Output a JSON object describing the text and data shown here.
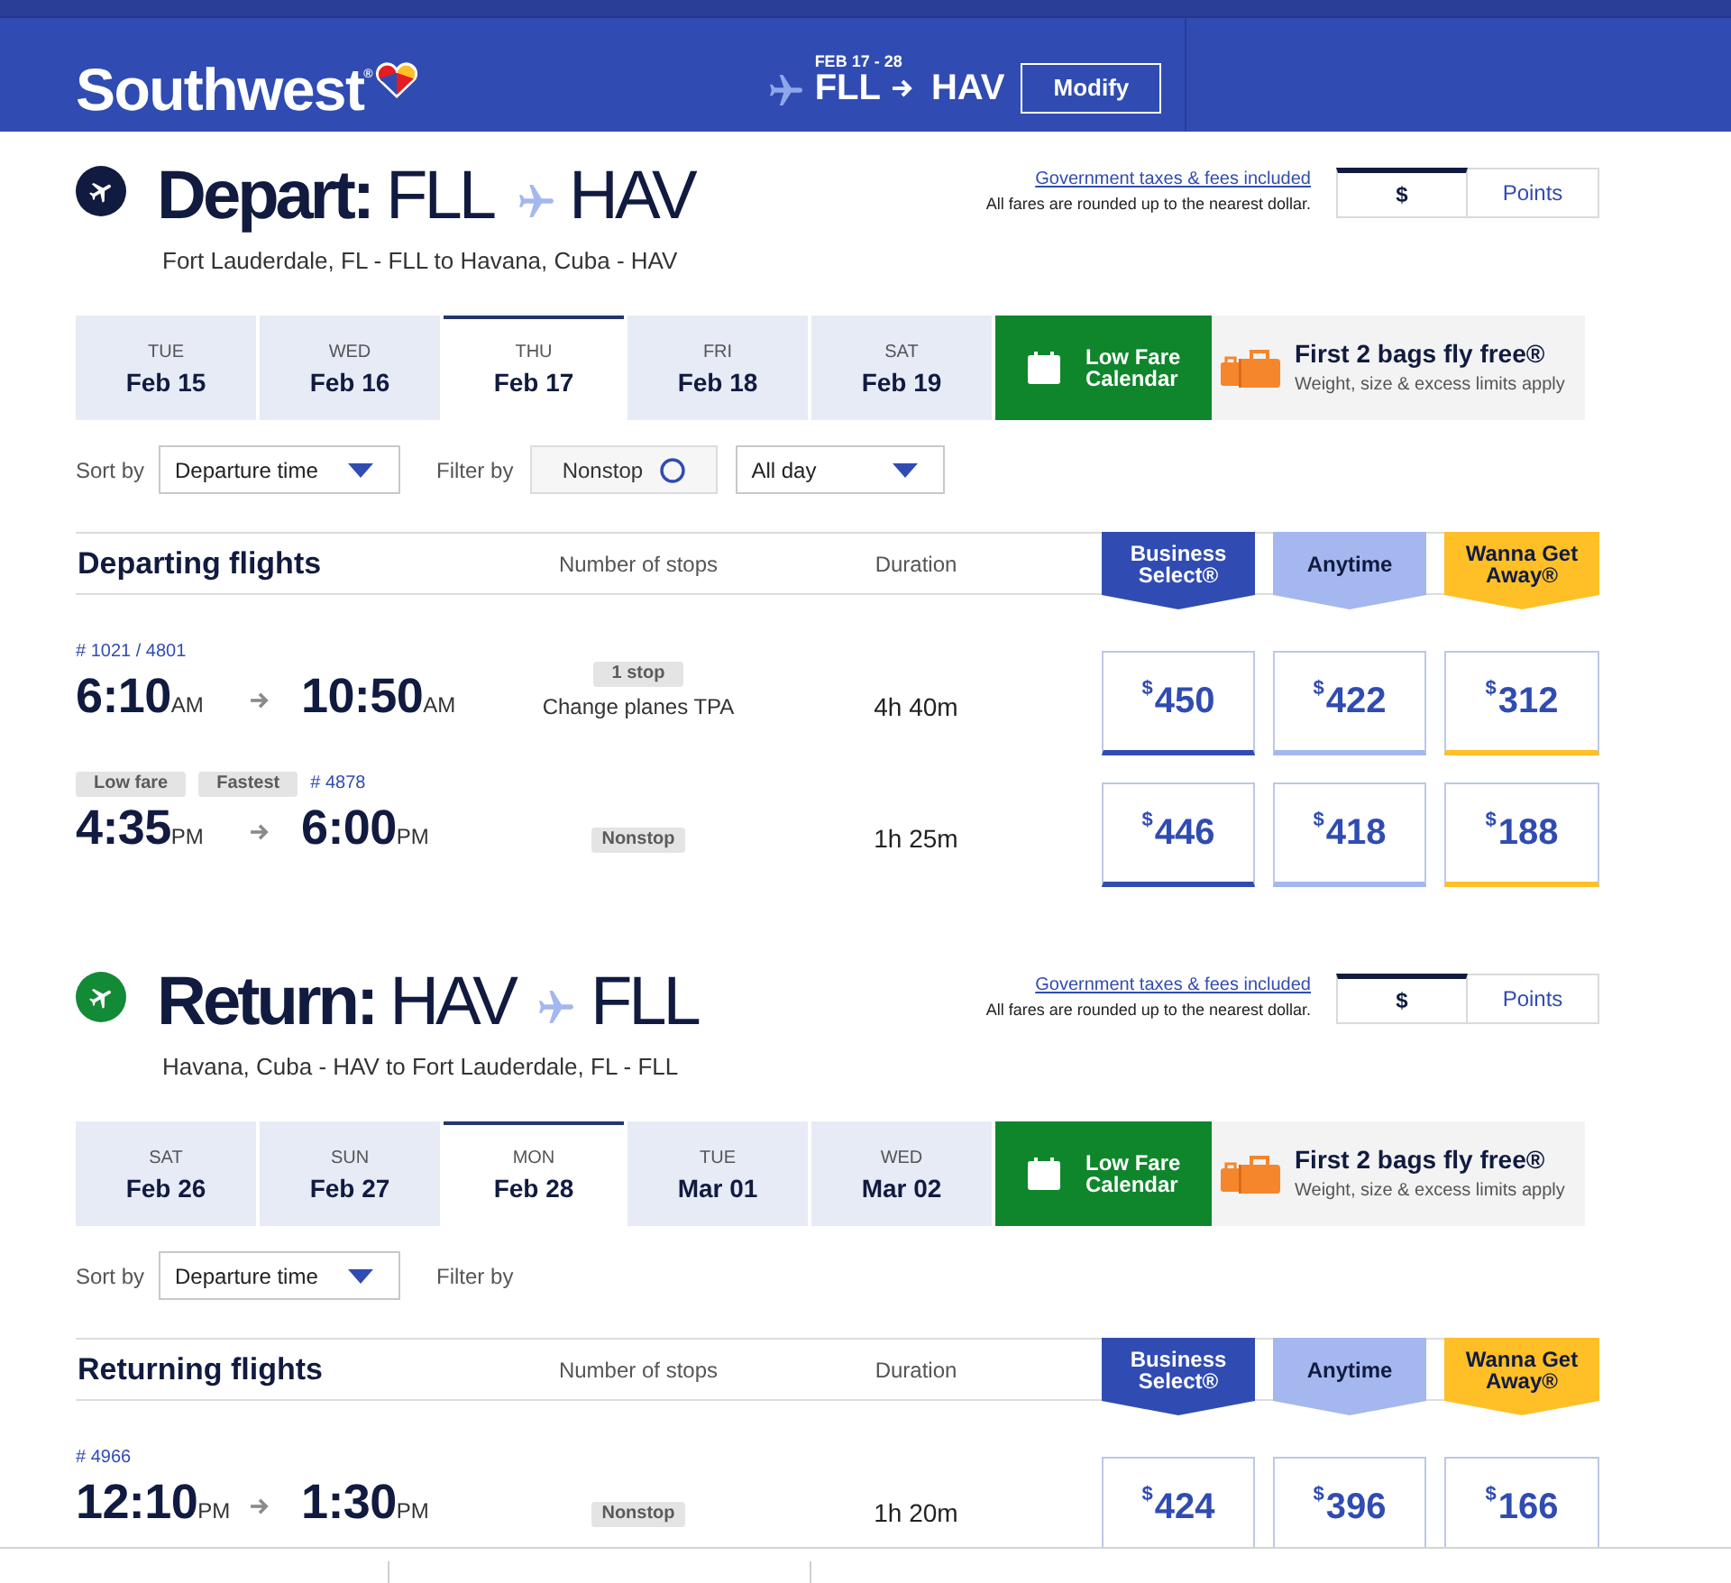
{
  "header": {
    "brand": "Southwest$^{®}$",
    "trip_dates": "FEB 17 - 28",
    "origin": "FLL",
    "destination": "HAV",
    "modify_button": "Modify"
  },
  "bounds": [
    {
      "color": "#111b40",
      "heading": "Depart:",
      "origin": "FLL",
      "destination": "HAV",
      "route": "Fort Lauderdale, FL - FLL to Havana, Cuba - HAV",
      "fees_link": "Government taxes & fees included",
      "fees_note": "All fares are rounded up to the nearest dollar.",
      "currency_toggle": [
        {
          "label": "$",
          "selected": true
        },
        {
          "label": "Points",
          "selected": false
        }
      ],
      "dates": [
        {
          "weekday": "TUE",
          "date": "Feb 15",
          "selected": false
        },
        {
          "weekday": "WED",
          "date": "Feb 16",
          "selected": false
        },
        {
          "weekday": "THU",
          "date": "Feb 17",
          "selected": true
        },
        {
          "weekday": "FRI",
          "date": "Feb 18",
          "selected": false
        },
        {
          "weekday": "SAT",
          "date": "Feb 19",
          "selected": false
        }
      ],
      "calendar_button": "Low Fare Calendar",
      "bags_promo": {
        "title": "First 2 bags fly free®",
        "note": "Weight, size & excess limits apply"
      },
      "sort": {
        "label": "Sort by",
        "value": "Departure time"
      },
      "filter": {
        "label": "Filter by",
        "nonstop": {
          "label": "Nonstop",
          "checked": false
        },
        "time_of_day": "All day"
      },
      "table": {
        "title": "Departing flights",
        "columns": [
          "Number of stops",
          "Duration"
        ],
        "fare_classes": [
          {
            "kind": "business",
            "name": "Business Select®",
            "color": "#304cb2"
          },
          {
            "kind": "anytime",
            "name": "Anytime",
            "color": "#a4b7ef"
          },
          {
            "kind": "wanna_get_away",
            "name": "Wanna Get Away®",
            "color": "#ffbf27"
          }
        ],
        "flights": [
          {
            "flight_number": "# 1021 / 4801",
            "depart_time": "6:10",
            "depart_period": "AM",
            "arrive_time": "10:50",
            "arrive_period": "AM",
            "stops": "1 stop",
            "connection": "Change planes TPA",
            "duration": "4h 40m",
            "fares": [
              {
                "currency": "$",
                "amount": "450"
              },
              {
                "currency": "$",
                "amount": "422"
              },
              {
                "currency": "$",
                "amount": "312"
              }
            ]
          },
          {
            "badges": [
              "Low fare",
              "Fastest"
            ],
            "flight_number": "# 4878",
            "depart_time": "4:35",
            "depart_period": "PM",
            "arrive_time": "6:00",
            "arrive_period": "PM",
            "stops": "Nonstop",
            "duration": "1h 25m",
            "fares": [
              {
                "currency": "$",
                "amount": "446"
              },
              {
                "currency": "$",
                "amount": "418"
              },
              {
                "currency": "$",
                "amount": "188"
              }
            ]
          }
        ]
      }
    },
    {
      "color": "#138a36",
      "heading": "Return:",
      "origin": "HAV",
      "destination": "FLL",
      "route": "Havana, Cuba - HAV to Fort Lauderdale, FL - FLL",
      "fees_link": "Government taxes & fees included",
      "fees_note": "All fares are rounded up to the nearest dollar.",
      "currency_toggle": [
        {
          "label": "$",
          "selected": true
        },
        {
          "label": "Points",
          "selected": false
        }
      ],
      "dates": [
        {
          "weekday": "SAT",
          "date": "Feb 26",
          "selected": false
        },
        {
          "weekday": "SUN",
          "date": "Feb 27",
          "selected": false
        },
        {
          "weekday": "MON",
          "date": "Feb 28",
          "selected": true
        },
        {
          "weekday": "TUE",
          "date": "Mar 01",
          "selected": false
        },
        {
          "weekday": "WED",
          "date": "Mar 02",
          "selected": false
        }
      ],
      "calendar_button": "Low Fare Calendar",
      "bags_promo": {
        "title": "First 2 bags fly free®",
        "note": "Weight, size & excess limits apply"
      },
      "sort": {
        "label": "Sort by",
        "value": "Departure time"
      },
      "filter": {
        "label": "Filter by"
      },
      "table": {
        "title": "Returning flights",
        "columns": [
          "Number of stops",
          "Duration"
        ],
        "fare_classes": [
          {
            "kind": "business",
            "name": "Business Select®",
            "color": "#304cb2"
          },
          {
            "kind": "anytime",
            "name": "Anytime",
            "color": "#a4b7ef"
          },
          {
            "kind": "wanna_get_away",
            "name": "Wanna Get Away®",
            "color": "#ffbf27"
          }
        ],
        "flights": [
          {
            "flight_number": "# 4966",
            "depart_time": "12:10",
            "depart_period": "PM",
            "arrive_time": "1:30",
            "arrive_period": "PM",
            "stops": "Nonstop",
            "duration": "1h 20m",
            "fares": [
              {
                "currency": "$",
                "amount": "424"
              },
              {
                "currency": "$",
                "amount": "396"
              },
              {
                "currency": "$",
                "amount": "166"
              }
            ]
          }
        ]
      }
    }
  ]
}
